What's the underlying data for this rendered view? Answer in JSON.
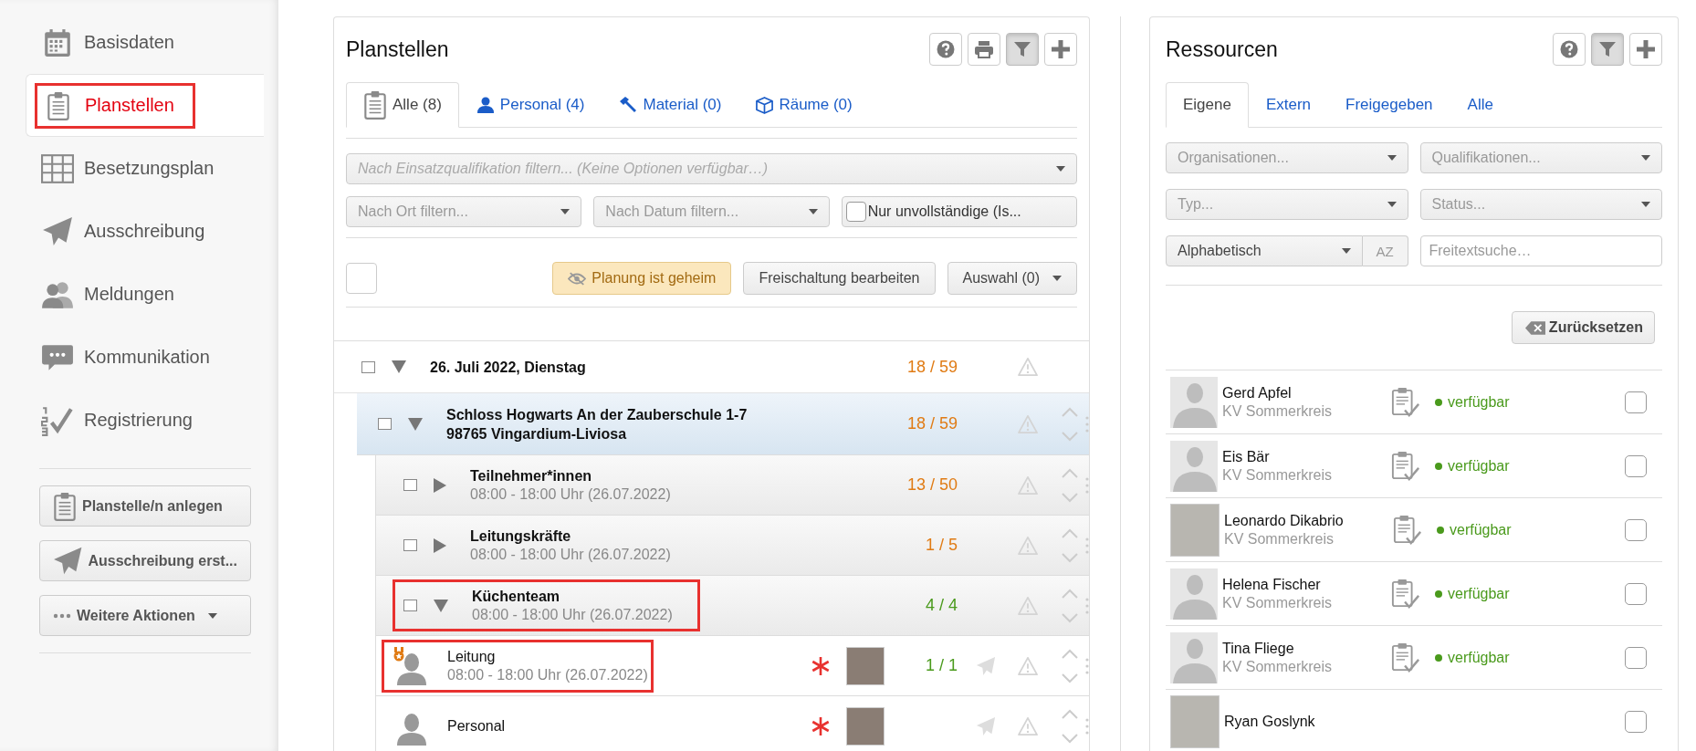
{
  "sidebar": {
    "items": [
      {
        "label": "Basisdaten",
        "selected": false,
        "highlighted": false
      },
      {
        "label": "Planstellen",
        "selected": true,
        "highlighted": true
      },
      {
        "label": "Besetzungsplan",
        "selected": false,
        "highlighted": false
      },
      {
        "label": "Ausschreibung",
        "selected": false,
        "highlighted": false
      },
      {
        "label": "Meldungen",
        "selected": false,
        "highlighted": false
      },
      {
        "label": "Kommunikation",
        "selected": false,
        "highlighted": false
      },
      {
        "label": "Registrierung",
        "selected": false,
        "highlighted": false
      }
    ],
    "buttons": [
      {
        "label": "Planstelle/n anlegen",
        "caret": false
      },
      {
        "label": "Ausschreibung erst...",
        "caret": false
      },
      {
        "label": "Weitere Aktionen",
        "caret": true
      }
    ]
  },
  "planstellen": {
    "title": "Planstellen",
    "tools": [
      {
        "active": false
      },
      {
        "active": false
      },
      {
        "active": true
      },
      {
        "active": false
      }
    ],
    "tabs": [
      {
        "label": "Alle (8)",
        "selected": true
      },
      {
        "label": "Personal (4)",
        "selected": false
      },
      {
        "label": "Material (0)",
        "selected": false
      },
      {
        "label": "Räume (0)",
        "selected": false
      }
    ],
    "filters": {
      "qualification": {
        "placeholder": "Nach Einsatzqualifikation filtern... (Keine Optionen verfügbar…)"
      },
      "location": {
        "placeholder": "Nach Ort filtern..."
      },
      "date": {
        "placeholder": "Nach Datum filtern..."
      },
      "incomplete": {
        "label": "Nur unvollständige (Is...",
        "checked": false
      }
    },
    "select_all": {
      "checked": false
    },
    "actions": {
      "secret": "Planung ist geheim",
      "release": "Freischaltung bearbeiten",
      "selection": "Auswahl (0)"
    },
    "tree": [
      {
        "kind": "date",
        "title": "26. Juli 2022, Dienstag",
        "count": "18 / 59",
        "complete": false,
        "checked": false,
        "expanded": true,
        "highlighted": false,
        "children": [
          {
            "kind": "location",
            "title": "Schloss Hogwarts An der Zauberschule 1-7 98765 Vingardium-Liviosa",
            "count": "18 / 59",
            "complete": false,
            "checked": false,
            "expanded": true,
            "highlighted": false,
            "children": [
              {
                "kind": "group",
                "title": "Teilnehmer*innen",
                "time": "08:00 - 18:00 Uhr (26.07.2022)",
                "count": "13 / 50",
                "complete": false,
                "checked": false,
                "expanded": false,
                "highlighted": false
              },
              {
                "kind": "group",
                "title": "Leitungskräfte",
                "time": "08:00 - 18:00 Uhr (26.07.2022)",
                "count": "1 / 5",
                "complete": false,
                "checked": false,
                "expanded": false,
                "highlighted": false
              },
              {
                "kind": "group",
                "title": "Küchenteam",
                "time": "08:00 - 18:00 Uhr (26.07.2022)",
                "count": "4 / 4",
                "complete": true,
                "checked": false,
                "expanded": true,
                "highlighted": true,
                "children": [
                  {
                    "kind": "position",
                    "title": "Leitung",
                    "time": "08:00 - 18:00 Uhr (26.07.2022)",
                    "count": "1 / 1",
                    "complete": true,
                    "lead": true,
                    "required": true,
                    "highlighted": true
                  },
                  {
                    "kind": "position",
                    "title": "Personal",
                    "required": true,
                    "lead": false,
                    "highlighted": false
                  }
                ]
              }
            ]
          }
        ]
      }
    ]
  },
  "ressourcen": {
    "title": "Ressourcen",
    "tools": [
      {
        "active": false
      },
      {
        "active": true
      },
      {
        "active": false
      }
    ],
    "tabs": [
      {
        "label": "Eigene",
        "selected": true
      },
      {
        "label": "Extern",
        "selected": false
      },
      {
        "label": "Freigegeben",
        "selected": false
      },
      {
        "label": "Alle",
        "selected": false
      }
    ],
    "filters": [
      {
        "placeholder": "Organisationen..."
      },
      {
        "placeholder": "Qualifikationen..."
      },
      {
        "placeholder": "Typ..."
      },
      {
        "placeholder": "Status..."
      }
    ],
    "sort": {
      "value": "Alphabetisch",
      "toggle": "AZ"
    },
    "search": {
      "placeholder": "Freitextsuche…"
    },
    "reset": "Zurücksetzen",
    "people": [
      {
        "name": "Gerd Apfel",
        "org": "KV Sommerkreis",
        "status": "verfügbar",
        "photo": false,
        "checked": false
      },
      {
        "name": "Eis Bär",
        "org": "KV Sommerkreis",
        "status": "verfügbar",
        "photo": false,
        "checked": false
      },
      {
        "name": "Leonardo Dikabrio",
        "org": "KV Sommerkreis",
        "status": "verfügbar",
        "photo": true,
        "checked": false
      },
      {
        "name": "Helena Fischer",
        "org": "KV Sommerkreis",
        "status": "verfügbar",
        "photo": false,
        "checked": false
      },
      {
        "name": "Tina Fliege",
        "org": "KV Sommerkreis",
        "status": "verfügbar",
        "photo": false,
        "checked": false
      },
      {
        "name": "Ryan Goslynk",
        "photo": true,
        "checked": false
      }
    ]
  }
}
